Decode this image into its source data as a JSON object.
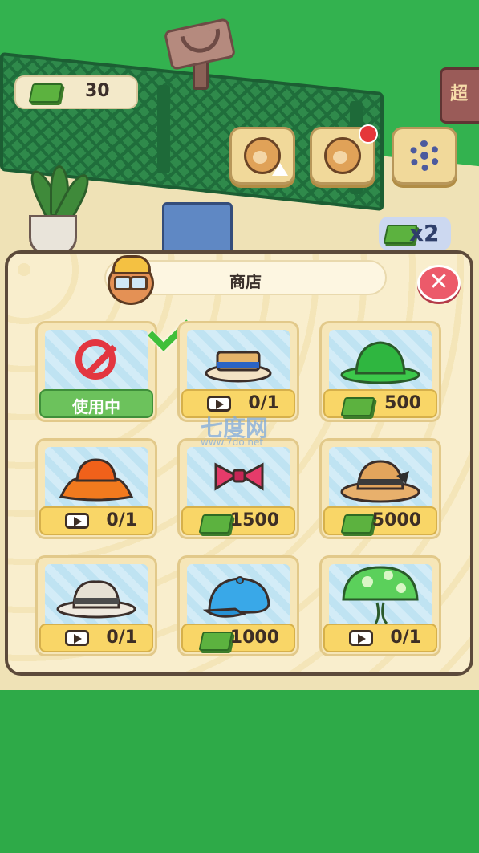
{
  "hud": {
    "cash_value": "30",
    "multiplier": "x2",
    "sign_text": "超"
  },
  "shop": {
    "title": "商店",
    "close_icon": "✕",
    "items": [
      {
        "name": "none",
        "icon": "no-hat-icon",
        "footer": "使用中",
        "type": "in-use",
        "selected": true
      },
      {
        "name": "boater-hat",
        "icon": "boater-hat-icon",
        "footer": "0/1",
        "type": "video"
      },
      {
        "name": "green-bucket-hat",
        "icon": "green-bucket-hat-icon",
        "footer": "500",
        "type": "cash"
      },
      {
        "name": "orange-bucket-hat",
        "icon": "orange-bucket-hat-icon",
        "footer": "0/1",
        "type": "video"
      },
      {
        "name": "bow-tie",
        "icon": "bow-tie-icon",
        "footer": "1500",
        "type": "cash"
      },
      {
        "name": "straw-hat",
        "icon": "straw-hat-icon",
        "footer": "5000",
        "type": "cash"
      },
      {
        "name": "white-fedora",
        "icon": "fedora-icon",
        "footer": "0/1",
        "type": "video"
      },
      {
        "name": "blue-cap",
        "icon": "newsboy-cap-icon",
        "footer": "1000",
        "type": "cash"
      },
      {
        "name": "mushroom-hat",
        "icon": "mushroom-hat-icon",
        "footer": "0/1",
        "type": "video"
      }
    ]
  },
  "watermark": {
    "main": "七度网",
    "url": "www.7do.net"
  }
}
